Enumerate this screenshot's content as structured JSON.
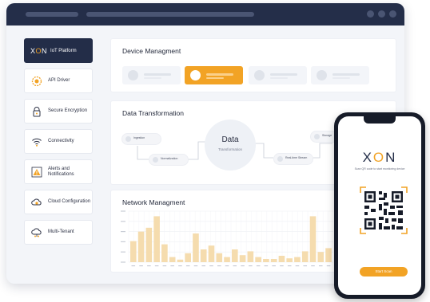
{
  "sidebar": {
    "brand": {
      "logo_x": "X",
      "logo_o": "O",
      "logo_n": "N",
      "label": "IoT Platform"
    },
    "items": [
      {
        "label": "API Driver",
        "icon": "api-icon"
      },
      {
        "label": "Secure Encryption",
        "icon": "lock-icon"
      },
      {
        "label": "Connectivity",
        "icon": "wifi-icon"
      },
      {
        "label": "Alerts and Notifications",
        "icon": "alert-icon"
      },
      {
        "label": "Cloud Configuration",
        "icon": "cloud-gear-icon"
      },
      {
        "label": "Multi-Tenant",
        "icon": "cloud-users-icon"
      }
    ]
  },
  "device_panel": {
    "title": "Device Managment",
    "selected_index": 1,
    "count": 4
  },
  "data_panel": {
    "title": "Data Transformation",
    "center_title": "Data",
    "center_sub": "Transformation",
    "nodes": {
      "n1": "Ingestion",
      "n2": "Normalization",
      "n3": "Storage",
      "n4": "Real-time Stream"
    }
  },
  "network_panel": {
    "title": "Network Managment",
    "chart_data": {
      "type": "bar",
      "values": [
        33,
        48,
        54,
        72,
        28,
        8,
        4,
        14,
        45,
        20,
        26,
        14,
        8,
        20,
        11,
        17,
        8,
        5,
        5,
        10,
        6,
        8,
        17,
        72,
        16,
        22
      ]
    }
  },
  "phone": {
    "logo_x": "X",
    "logo_o": "O",
    "logo_n": "N",
    "tagline": "Scan QR code to start monitoring device",
    "scan_button": "Start Scan"
  },
  "colors": {
    "accent": "#f2a325",
    "navy": "#232d48",
    "bar": "#f5dcae"
  }
}
